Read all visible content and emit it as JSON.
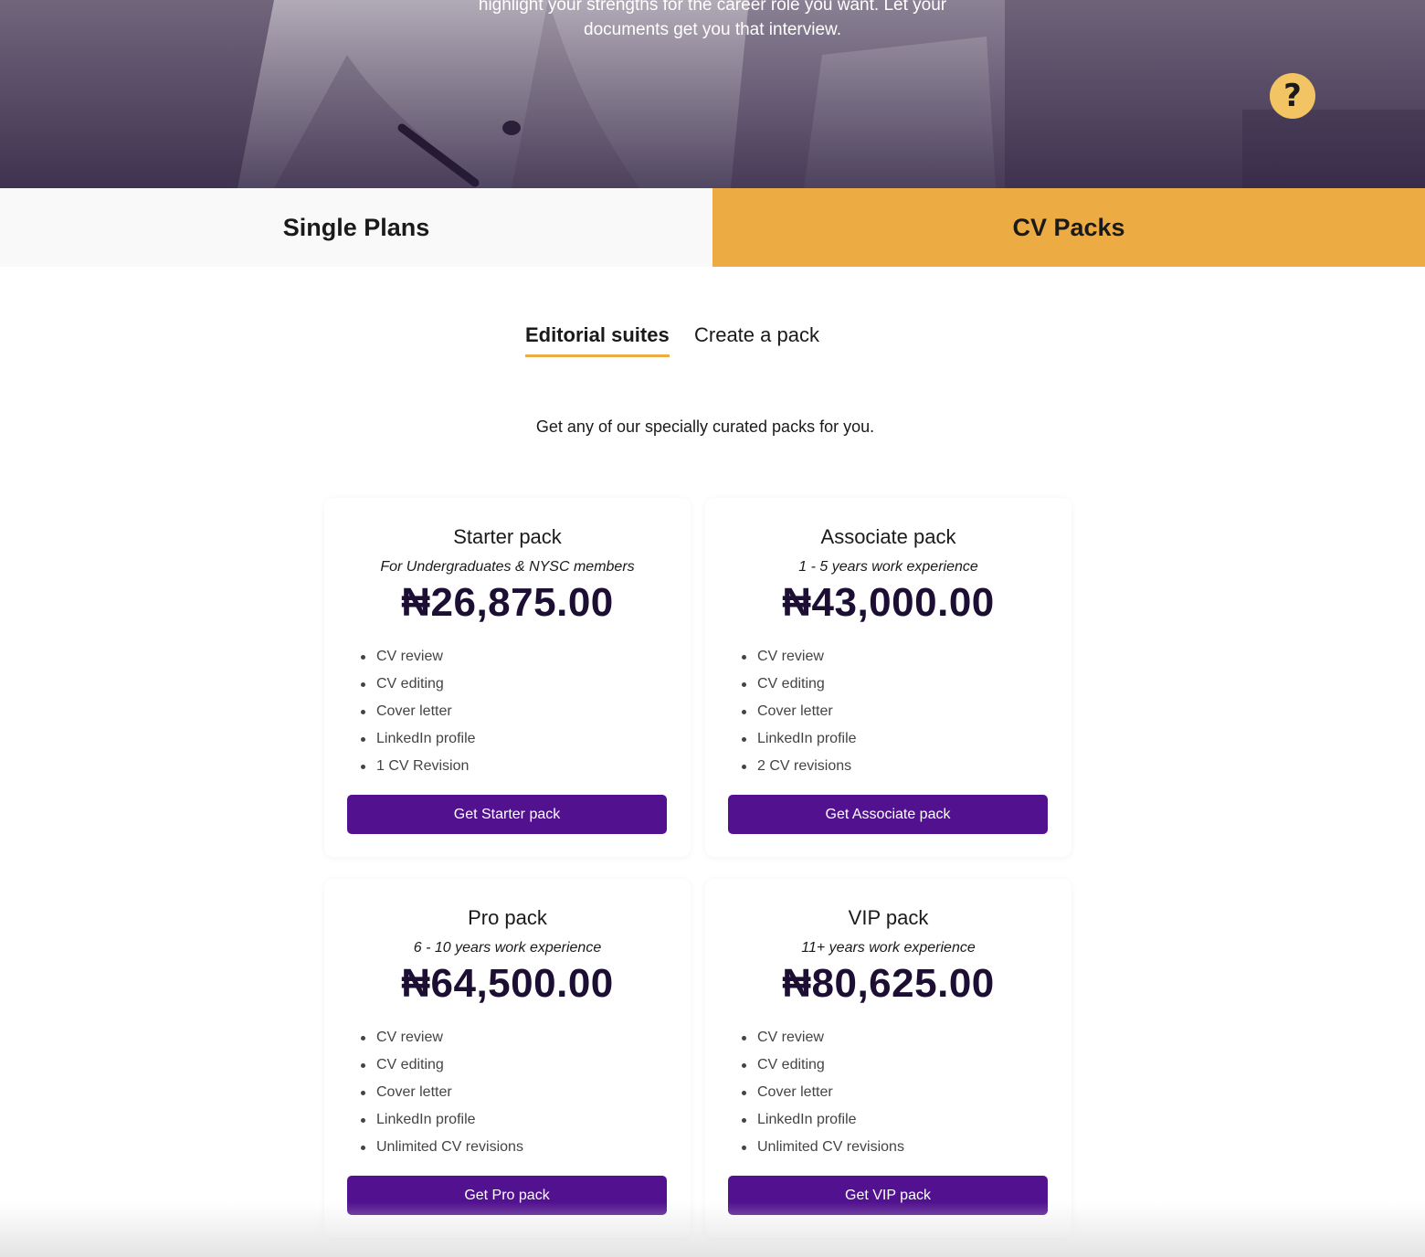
{
  "hero": {
    "line1": "highlight your strengths for the career role you want. Let your",
    "line2": "documents get you that interview.",
    "help_icon": "question-mark-icon",
    "help_glyph": "?"
  },
  "plan_tabs": [
    {
      "label": "Single Plans"
    },
    {
      "label": "CV Packs"
    }
  ],
  "sub_tabs": [
    {
      "label": "Editorial suites"
    },
    {
      "label": "Create a pack"
    }
  ],
  "intro": "Get any of our specially curated packs for you.",
  "colors": {
    "accent": "#ecab43",
    "button": "#52128f",
    "price": "#1c0f33",
    "help": "#f2c463"
  },
  "packs": [
    {
      "title": "Starter pack",
      "subtitle": "For Undergraduates & NYSC members",
      "price": "₦26,875.00",
      "features": [
        "CV review",
        "CV editing",
        "Cover letter",
        "LinkedIn profile",
        "1 CV Revision"
      ],
      "button": "Get Starter pack"
    },
    {
      "title": "Associate pack",
      "subtitle": "1 - 5 years work experience",
      "price": "₦43,000.00",
      "features": [
        "CV review",
        "CV editing",
        "Cover letter",
        "LinkedIn profile",
        "2 CV revisions"
      ],
      "button": "Get Associate pack"
    },
    {
      "title": "Pro pack",
      "subtitle": "6 - 10 years work experience",
      "price": "₦64,500.00",
      "features": [
        "CV review",
        "CV editing",
        "Cover letter",
        "LinkedIn profile",
        "Unlimited CV revisions"
      ],
      "button": "Get Pro pack"
    },
    {
      "title": "VIP pack",
      "subtitle": "11+ years work experience",
      "price": "₦80,625.00",
      "features": [
        "CV review",
        "CV editing",
        "Cover letter",
        "LinkedIn profile",
        "Unlimited CV revisions"
      ],
      "button": "Get VIP pack"
    }
  ]
}
